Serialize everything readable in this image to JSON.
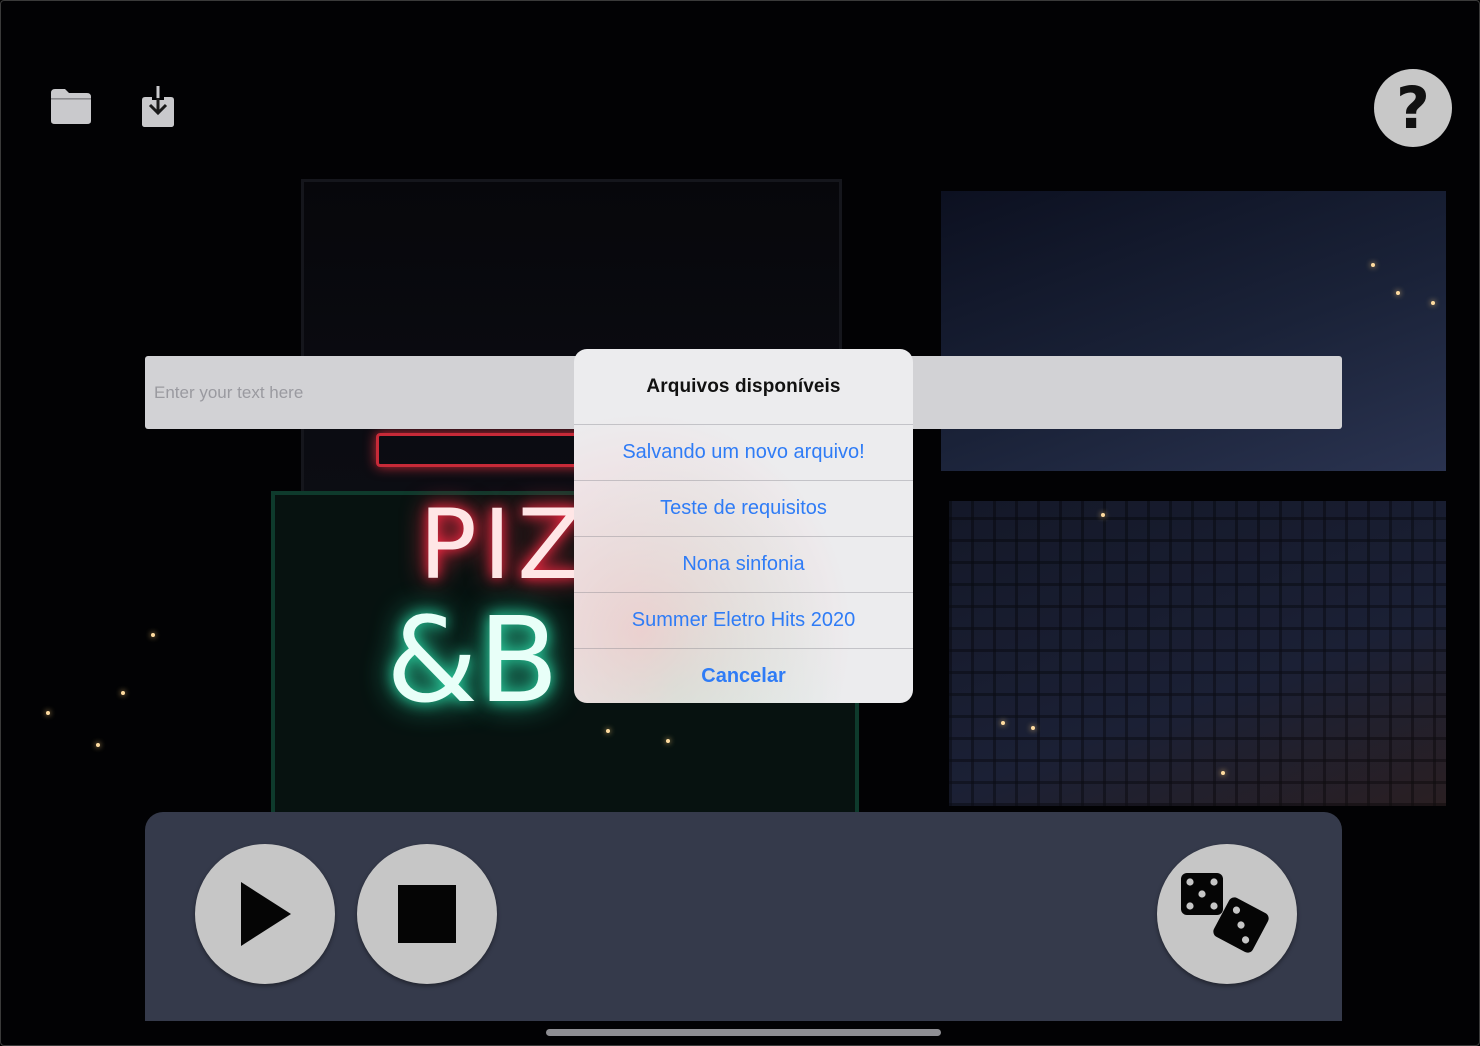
{
  "toolbar": {
    "folder_icon": "folder-icon",
    "download_icon": "download-icon",
    "help_label": "?"
  },
  "text_input": {
    "placeholder": "Enter your text here",
    "value": ""
  },
  "action_sheet": {
    "title": "Arquivos disponíveis",
    "items": [
      {
        "label": "Salvando um novo arquivo!"
      },
      {
        "label": "Teste de requisitos"
      },
      {
        "label": "Nona sinfonia"
      },
      {
        "label": "Summer Eletro Hits 2020"
      }
    ],
    "cancel_label": "Cancelar",
    "accent_color": "#2f7cf6"
  },
  "controls": {
    "play_icon": "play-icon",
    "stop_icon": "stop-icon",
    "dice_icon": "dice-icon",
    "panel_color": "#353a4b",
    "button_color": "#c6c6c6"
  }
}
